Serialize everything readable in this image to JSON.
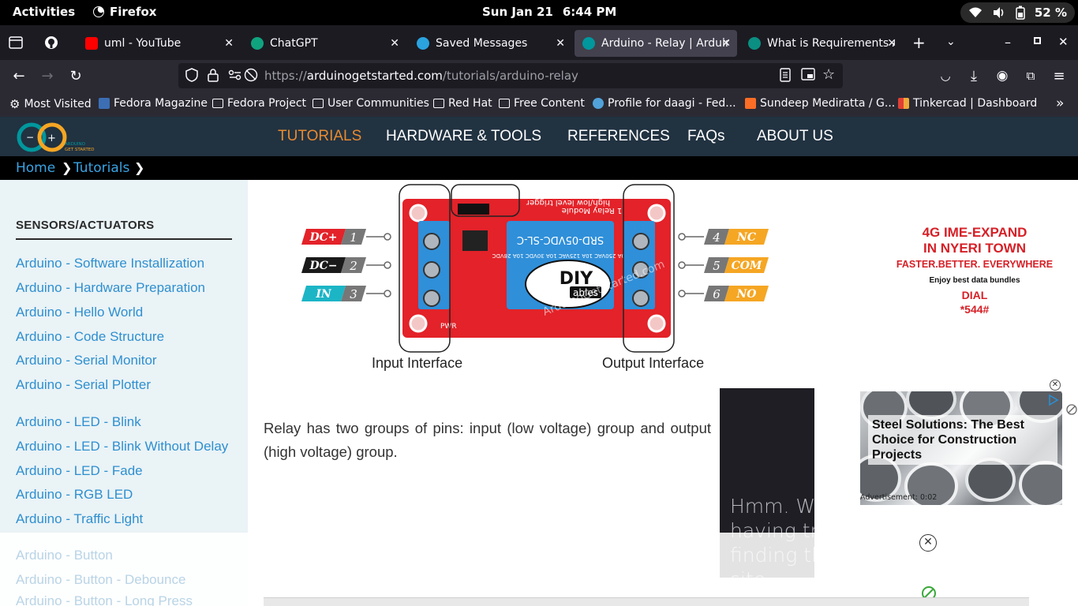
{
  "gnome": {
    "activities": "Activities",
    "app": "Firefox",
    "date": "Sun Jan 21",
    "time": "6:44 PM",
    "battery": "52 %"
  },
  "tabs": [
    {
      "title": "uml - YouTube",
      "color": "#ff0000"
    },
    {
      "title": "ChatGPT",
      "color": "#10a37f"
    },
    {
      "title": "Saved Messages",
      "color": "#2aa3df"
    },
    {
      "title": "Arduino - Relay | Arduino Getting Started",
      "color": "#00979d"
    },
    {
      "title": "What is Requirements Analysis",
      "color": "#0b8f82"
    }
  ],
  "url": {
    "prefix": "https://",
    "domain": "arduinogetstarted.com",
    "path": "/tutorials/arduino-relay"
  },
  "bookmarks": [
    "Most Visited",
    "Fedora Magazine",
    "Fedora Project",
    "User Communities",
    "Red Hat",
    "Free Content",
    "Profile for daagi - Fed...",
    "Sundeep Mediratta / G...",
    "Tinkercad | Dashboard"
  ],
  "site": {
    "logo_text": "ARDUINO GET STARTED",
    "menu": [
      "TUTORIALS",
      "HARDWARE & TOOLS",
      "REFERENCES",
      "FAQs",
      "ABOUT US"
    ],
    "breadcrumb": [
      "Home",
      "Tutorials"
    ]
  },
  "sidebar": {
    "heading": "SENSORS/ACTUATORS",
    "group1": [
      "Arduino - Software Installization",
      "Arduino - Hardware Preparation",
      "Arduino - Hello World",
      "Arduino - Code Structure",
      "Arduino - Serial Monitor",
      "Arduino - Serial Plotter"
    ],
    "group2": [
      "Arduino - LED - Blink",
      "Arduino - LED - Blink Without Delay",
      "Arduino - LED - Fade",
      "Arduino - RGB LED",
      "Arduino - Traffic Light"
    ],
    "faded": [
      "Arduino - Button",
      "Arduino - Button - Debounce",
      "Arduino - Button - Long Press"
    ]
  },
  "figure": {
    "left_pins": [
      {
        "label": "DC+",
        "num": "1",
        "color": "#e32229"
      },
      {
        "label": "DC−",
        "num": "2",
        "color": "#1a1a1a"
      },
      {
        "label": "IN",
        "num": "3",
        "color": "#1bb5c6"
      }
    ],
    "right_pins": [
      {
        "num": "4",
        "label": "NC",
        "color": "#f5a623"
      },
      {
        "num": "5",
        "label": "COM",
        "color": "#f5a623"
      },
      {
        "num": "6",
        "label": "NO",
        "color": "#f5a623"
      }
    ],
    "relay_text": "SRD-05VDC-SL-C",
    "board_text": "1 Relay Module",
    "board_text2": "high/low level trigger",
    "relay_spec": "10A 250VAC 10A 125VAC 10A 30VDC 10A 28VDC",
    "brand": "DIY",
    "brand_sub": "ables",
    "watermark": "ArduinoGetStarted.com",
    "pwr_label": "PWR",
    "input_label": "Input Interface",
    "output_label": "Output Interface"
  },
  "content": {
    "paragraph": "Relay has two groups of pins: input (low voltage) group and output (high voltage) group.",
    "video_error": "Hmm. We're having trouble finding that site."
  },
  "ads": {
    "telco": {
      "line1": "4G IME-EXPAND",
      "line2": "IN NYERI TOWN",
      "line3": "FASTER.BETTER. EVERYWHERE",
      "line4": "Enjoy best data bundles",
      "line5": "DIAL",
      "line6": "*544#"
    },
    "steel": {
      "headline": "Steel Solutions: The Best Choice for Construction Projects",
      "label": "Advertisement: 0:02"
    }
  }
}
